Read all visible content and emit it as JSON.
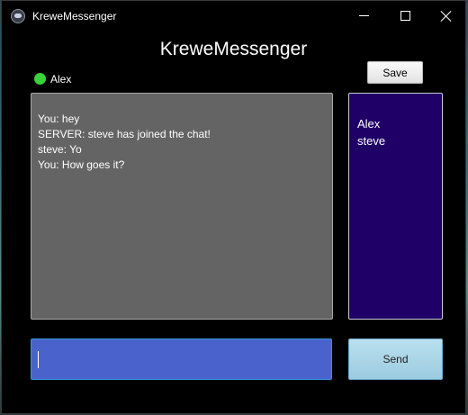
{
  "window": {
    "title": "KreweMessenger",
    "icon": "krewe-messenger-app-icon"
  },
  "header": {
    "title": "KreweMessenger"
  },
  "status": {
    "user": "Alex",
    "color": "#39d339"
  },
  "toolbar": {
    "save_label": "Save"
  },
  "chat": {
    "messages": [
      "You: hey",
      "SERVER: steve has joined the chat!",
      "steve:  Yo",
      "You: How goes it?"
    ]
  },
  "users": {
    "items": [
      "Alex",
      "steve"
    ]
  },
  "composer": {
    "value": "",
    "send_label": "Send"
  },
  "colors": {
    "chat_bg": "#646464",
    "user_list_bg": "#1e0066",
    "input_bg": "#4a63cc",
    "send_bg": "#9ccbe0"
  }
}
